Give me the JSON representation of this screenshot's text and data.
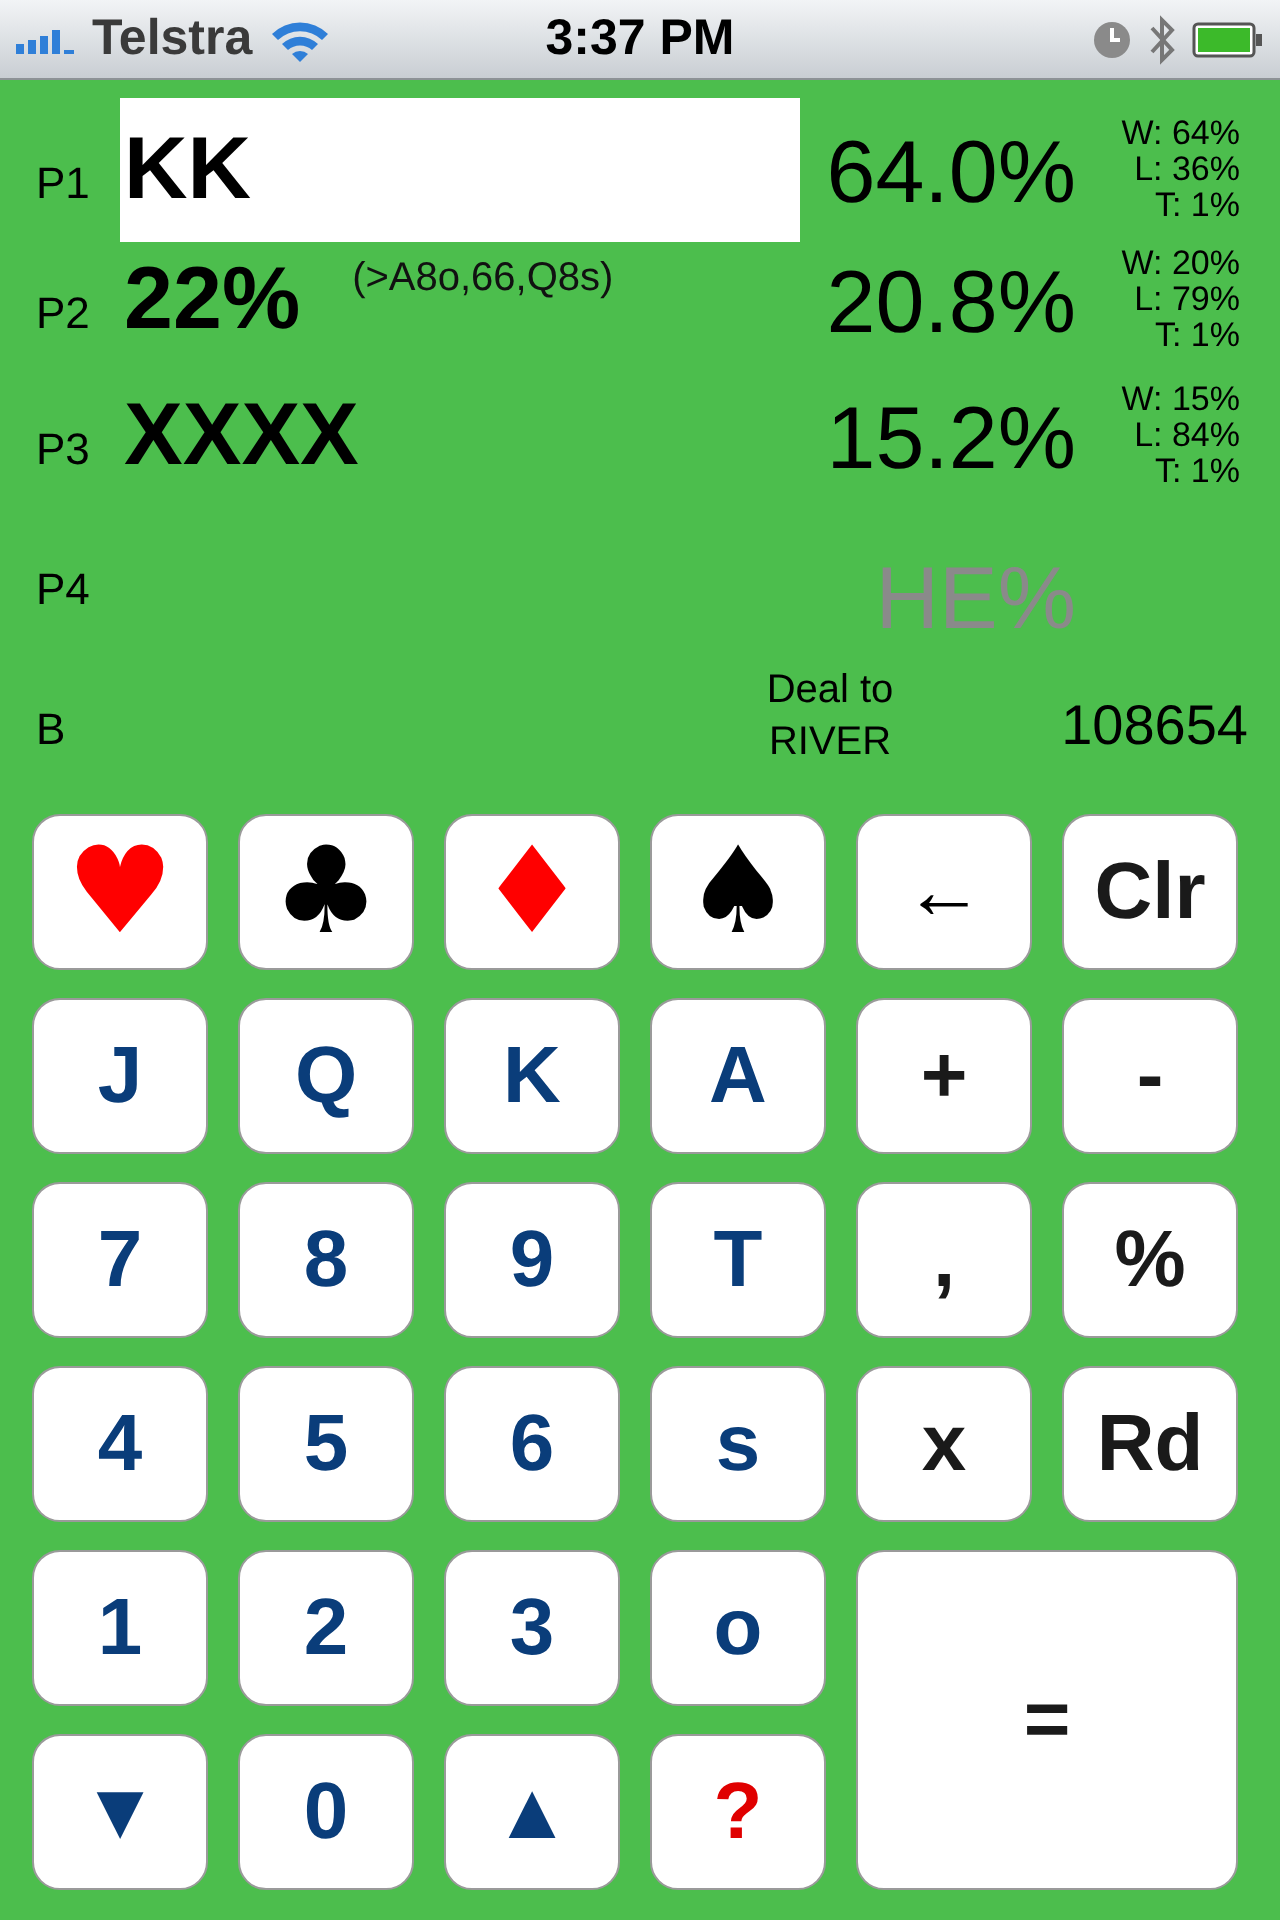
{
  "status_bar": {
    "carrier": "Telstra",
    "time": "3:37 PM"
  },
  "players": [
    {
      "label": "P1",
      "hand": "KK",
      "selected": true,
      "equity": "64.0%",
      "win": "W: 64%",
      "loss": "L: 36%",
      "tie": "T: 1%"
    },
    {
      "label": "P2",
      "hand": "22%",
      "range": "(>A8o,66,Q8s)",
      "selected": false,
      "equity": "20.8%",
      "win": "W: 20%",
      "loss": "L: 79%",
      "tie": "T: 1%"
    },
    {
      "label": "P3",
      "hand": "XXXX",
      "selected": false,
      "equity": "15.2%",
      "win": "W: 15%",
      "loss": "L: 84%",
      "tie": "T: 1%"
    },
    {
      "label": "P4",
      "selected": false,
      "equity_placeholder": "HE%"
    }
  ],
  "board": {
    "label": "B",
    "deal": "Deal to RIVER",
    "count": "108654"
  },
  "keys": [
    {
      "label": "♥",
      "kind": "suit",
      "color": "#ff0000"
    },
    {
      "label": "♣",
      "kind": "suit",
      "color": "#000000"
    },
    {
      "label": "♦",
      "kind": "suit",
      "color": "#ff0000"
    },
    {
      "label": "♠",
      "kind": "suit",
      "color": "#000000"
    },
    {
      "label": "←",
      "kind": "op",
      "color": "#000000"
    },
    {
      "label": "Clr",
      "kind": "op",
      "color": "#1a1a1a"
    },
    {
      "label": "J",
      "kind": "rank",
      "color": "#0a3d7a"
    },
    {
      "label": "Q",
      "kind": "rank",
      "color": "#0a3d7a"
    },
    {
      "label": "K",
      "kind": "rank",
      "color": "#0a3d7a"
    },
    {
      "label": "A",
      "kind": "rank",
      "color": "#0a3d7a"
    },
    {
      "label": "+",
      "kind": "op",
      "color": "#1a1a1a"
    },
    {
      "label": "-",
      "kind": "op",
      "color": "#1a1a1a"
    },
    {
      "label": "7",
      "kind": "rank",
      "color": "#0a3d7a"
    },
    {
      "label": "8",
      "kind": "rank",
      "color": "#0a3d7a"
    },
    {
      "label": "9",
      "kind": "rank",
      "color": "#0a3d7a"
    },
    {
      "label": "T",
      "kind": "rank",
      "color": "#0a3d7a"
    },
    {
      "label": ",",
      "kind": "op",
      "color": "#1a1a1a"
    },
    {
      "label": "%",
      "kind": "op",
      "color": "#1a1a1a"
    },
    {
      "label": "4",
      "kind": "rank",
      "color": "#0a3d7a"
    },
    {
      "label": "5",
      "kind": "rank",
      "color": "#0a3d7a"
    },
    {
      "label": "6",
      "kind": "rank",
      "color": "#0a3d7a"
    },
    {
      "label": "s",
      "kind": "rank",
      "color": "#0a3d7a"
    },
    {
      "label": "x",
      "kind": "op",
      "color": "#1a1a1a"
    },
    {
      "label": "Rd",
      "kind": "op",
      "color": "#1a1a1a"
    },
    {
      "label": "1",
      "kind": "rank",
      "color": "#0a3d7a"
    },
    {
      "label": "2",
      "kind": "rank",
      "color": "#0a3d7a"
    },
    {
      "label": "3",
      "kind": "rank",
      "color": "#0a3d7a"
    },
    {
      "label": "o",
      "kind": "rank",
      "color": "#0a3d7a"
    },
    {
      "label": "=",
      "kind": "wide",
      "color": "#1a1a1a"
    },
    {
      "label": "▼",
      "kind": "rank",
      "color": "#0a3d7a"
    },
    {
      "label": "0",
      "kind": "rank",
      "color": "#0a3d7a"
    },
    {
      "label": "▲",
      "kind": "rank",
      "color": "#0a3d7a"
    },
    {
      "label": "?",
      "kind": "op",
      "color": "#e00000"
    }
  ]
}
